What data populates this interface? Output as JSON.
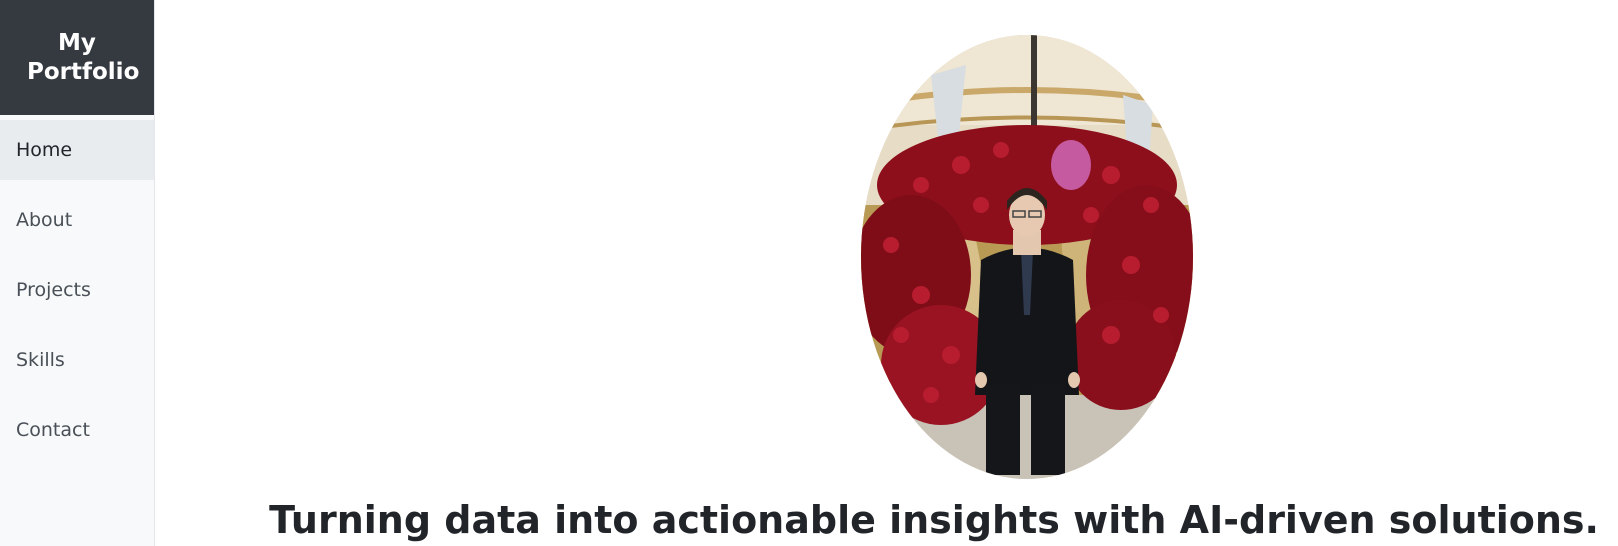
{
  "sidebar": {
    "brand": "My Portfolio",
    "items": [
      {
        "label": "Home",
        "active": true
      },
      {
        "label": "About",
        "active": false
      },
      {
        "label": "Projects",
        "active": false
      },
      {
        "label": "Skills",
        "active": false
      },
      {
        "label": "Contact",
        "active": false
      }
    ]
  },
  "main": {
    "tagline": "Turning data into actionable insights with AI-driven solutions."
  },
  "colors": {
    "brand_bg": "#343a40",
    "sidebar_bg": "#f8f9fa",
    "active_bg": "#e9ecef"
  }
}
